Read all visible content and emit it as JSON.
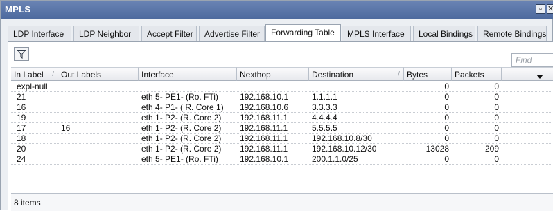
{
  "window": {
    "title": "MPLS"
  },
  "tabs": [
    {
      "label": "LDP Interface"
    },
    {
      "label": "LDP Neighbor"
    },
    {
      "label": "Accept Filter"
    },
    {
      "label": "Advertise Filter"
    },
    {
      "label": "Forwarding Table",
      "active": true
    },
    {
      "label": "MPLS Interface"
    },
    {
      "label": "Local Bindings"
    },
    {
      "label": "Remote Bindings"
    }
  ],
  "toolbar": {
    "filter_icon": "filter-icon",
    "find_placeholder": "Find"
  },
  "table": {
    "columns": [
      "In Label",
      "Out Labels",
      "Interface",
      "Nexthop",
      "Destination",
      "Bytes",
      "Packets"
    ],
    "sort_marks": [
      "/",
      "/"
    ],
    "rows": [
      {
        "in_label": "expl-null",
        "out_labels": "",
        "interface": "",
        "nexthop": "",
        "destination": "",
        "bytes": "0",
        "packets": "0"
      },
      {
        "in_label": "21",
        "out_labels": "",
        "interface": "eth 5- PE1- (Ro. FTi)",
        "nexthop": "192.168.10.1",
        "destination": "1.1.1.1",
        "bytes": "0",
        "packets": "0"
      },
      {
        "in_label": "16",
        "out_labels": "",
        "interface": "eth 4- P1- ( R. Core 1)",
        "nexthop": "192.168.10.6",
        "destination": "3.3.3.3",
        "bytes": "0",
        "packets": "0"
      },
      {
        "in_label": "19",
        "out_labels": "",
        "interface": "eth 1- P2- (R. Core 2)",
        "nexthop": "192.168.11.1",
        "destination": "4.4.4.4",
        "bytes": "0",
        "packets": "0"
      },
      {
        "in_label": "17",
        "out_labels": "16",
        "interface": "eth 1- P2- (R. Core 2)",
        "nexthop": "192.168.11.1",
        "destination": "5.5.5.5",
        "bytes": "0",
        "packets": "0"
      },
      {
        "in_label": "18",
        "out_labels": "",
        "interface": "eth 1- P2- (R. Core 2)",
        "nexthop": "192.168.11.1",
        "destination": "192.168.10.8/30",
        "bytes": "0",
        "packets": "0"
      },
      {
        "in_label": "20",
        "out_labels": "",
        "interface": "eth 1- P2- (R. Core 2)",
        "nexthop": "192.168.11.1",
        "destination": "192.168.10.12/30",
        "bytes": "13028",
        "packets": "209"
      },
      {
        "in_label": "24",
        "out_labels": "",
        "interface": "eth 5- PE1- (Ro. FTi)",
        "nexthop": "192.168.10.1",
        "destination": "200.1.1.0/25",
        "bytes": "0",
        "packets": "0"
      }
    ]
  },
  "status": {
    "items_count": "8 items"
  }
}
